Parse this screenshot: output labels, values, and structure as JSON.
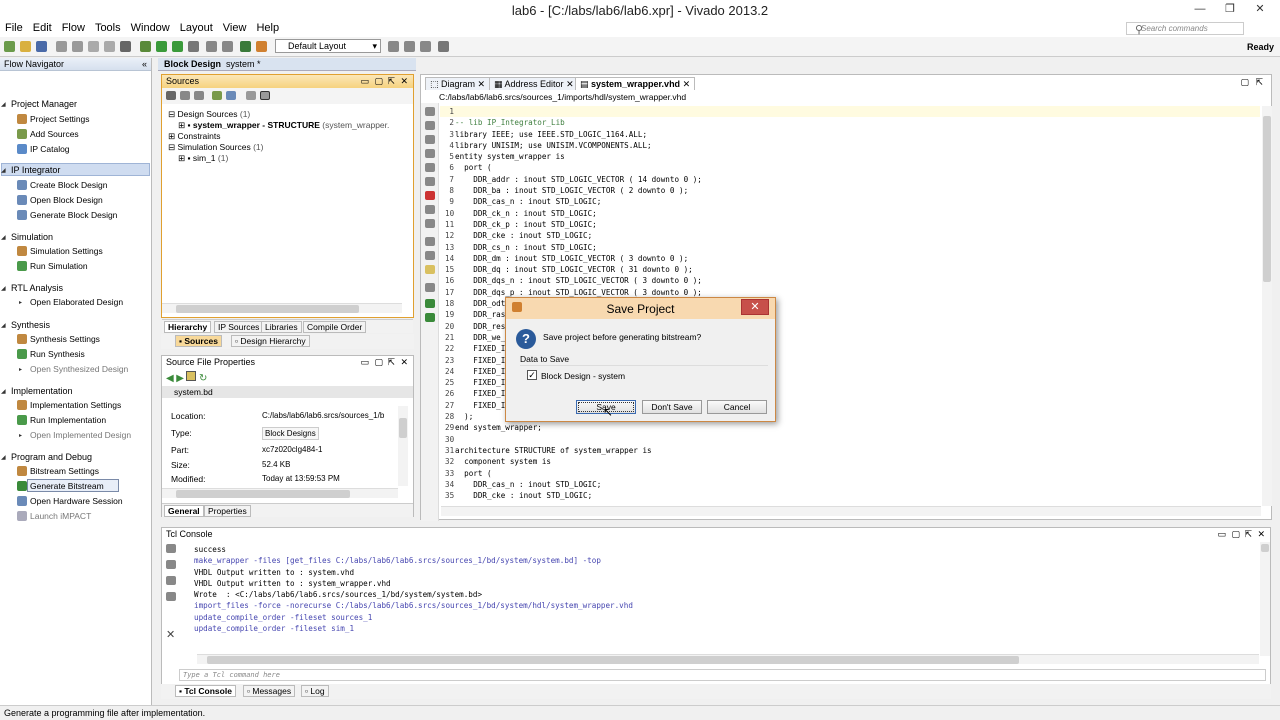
{
  "window": {
    "title": "lab6 - [C:/labs/lab6/lab6.xpr] - Vivado 2013.2",
    "min": "—",
    "max": "❐",
    "close": "✕"
  },
  "menu": [
    "File",
    "Edit",
    "Flow",
    "Tools",
    "Window",
    "Layout",
    "View",
    "Help"
  ],
  "search": {
    "placeholder": "Search commands"
  },
  "toolbar": {
    "layout": "Default Layout",
    "status": "Ready"
  },
  "flow_navigator": {
    "title": "Flow Navigator",
    "sections": [
      {
        "label": "Project Manager",
        "items": [
          "Project Settings",
          "Add Sources",
          "IP Catalog"
        ]
      },
      {
        "label": "IP Integrator",
        "items": [
          "Create Block Design",
          "Open Block Design",
          "Generate Block Design"
        ]
      },
      {
        "label": "Simulation",
        "items": [
          "Simulation Settings",
          "Run Simulation"
        ]
      },
      {
        "label": "RTL Analysis",
        "items": [
          "Open Elaborated Design"
        ]
      },
      {
        "label": "Synthesis",
        "items": [
          "Synthesis Settings",
          "Run Synthesis",
          "Open Synthesized Design"
        ]
      },
      {
        "label": "Implementation",
        "items": [
          "Implementation Settings",
          "Run Implementation",
          "Open Implemented Design"
        ]
      },
      {
        "label": "Program and Debug",
        "items": [
          "Bitstream Settings",
          "Generate Bitstream",
          "Open Hardware Session",
          "Launch iMPACT"
        ]
      }
    ]
  },
  "block_design": {
    "title": "Block Design",
    "name": "system *"
  },
  "sources": {
    "title": "Sources",
    "design_sources": "Design Sources",
    "design_count": "(1)",
    "wrapper": "system_wrapper - STRUCTURE",
    "wrapper_file": "(system_wrapper.",
    "constraints": "Constraints",
    "sim_sources": "Simulation Sources",
    "sim_count": "(1)",
    "sim1": "sim_1",
    "sim1_count": "(1)",
    "tabs": [
      "Hierarchy",
      "IP Sources",
      "Libraries",
      "Compile Order"
    ],
    "subtabs": [
      "Sources",
      "Design Hierarchy"
    ]
  },
  "sfp": {
    "title": "Source File Properties",
    "file": "system.bd",
    "props": [
      {
        "label": "Location:",
        "value": "C:/labs/lab6/lab6.srcs/sources_1/b"
      },
      {
        "label": "Type:",
        "value": "Block Designs"
      },
      {
        "label": "Part:",
        "value": "xc7z020clg484-1"
      },
      {
        "label": "Size:",
        "value": "52.4 KB"
      },
      {
        "label": "Modified:",
        "value": "Today at 13:59:53 PM"
      }
    ],
    "tabs": [
      "General",
      "Properties"
    ]
  },
  "editor": {
    "tabs": [
      "Diagram",
      "Address Editor",
      "system_wrapper.vhd"
    ],
    "path": "C:/labs/lab6/lab6.srcs/sources_1/imports/hdl/system_wrapper.vhd",
    "lines": [
      {
        "n": "1",
        "t": ""
      },
      {
        "n": "2",
        "t": "-- lib IP_Integrator_Lib"
      },
      {
        "n": "3",
        "t": "library IEEE; use IEEE.STD_LOGIC_1164.ALL;"
      },
      {
        "n": "4",
        "t": "library UNISIM; use UNISIM.VCOMPONENTS.ALL;"
      },
      {
        "n": "5",
        "t": "entity system_wrapper is"
      },
      {
        "n": "6",
        "t": "  port ("
      },
      {
        "n": "7",
        "t": "    DDR_addr : inout STD_LOGIC_VECTOR ( 14 downto 0 );"
      },
      {
        "n": "8",
        "t": "    DDR_ba : inout STD_LOGIC_VECTOR ( 2 downto 0 );"
      },
      {
        "n": "9",
        "t": "    DDR_cas_n : inout STD_LOGIC;"
      },
      {
        "n": "10",
        "t": "    DDR_ck_n : inout STD_LOGIC;"
      },
      {
        "n": "11",
        "t": "    DDR_ck_p : inout STD_LOGIC;"
      },
      {
        "n": "12",
        "t": "    DDR_cke : inout STD_LOGIC;"
      },
      {
        "n": "13",
        "t": "    DDR_cs_n : inout STD_LOGIC;"
      },
      {
        "n": "14",
        "t": "    DDR_dm : inout STD_LOGIC_VECTOR ( 3 downto 0 );"
      },
      {
        "n": "15",
        "t": "    DDR_dq : inout STD_LOGIC_VECTOR ( 31 downto 0 );"
      },
      {
        "n": "16",
        "t": "    DDR_dqs_n : inout STD_LOGIC_VECTOR ( 3 downto 0 );"
      },
      {
        "n": "17",
        "t": "    DDR_dqs_p : inout STD_LOGIC_VECTOR ( 3 downto 0 );"
      },
      {
        "n": "18",
        "t": "    DDR_odt"
      },
      {
        "n": "19",
        "t": "    DDR_ras"
      },
      {
        "n": "20",
        "t": "    DDR_res"
      },
      {
        "n": "21",
        "t": "    DDR_we_"
      },
      {
        "n": "22",
        "t": "    FIXED_I"
      },
      {
        "n": "23",
        "t": "    FIXED_I"
      },
      {
        "n": "24",
        "t": "    FIXED_I"
      },
      {
        "n": "25",
        "t": "    FIXED_I"
      },
      {
        "n": "26",
        "t": "    FIXED_I"
      },
      {
        "n": "27",
        "t": "    FIXED_I"
      },
      {
        "n": "28",
        "t": "  );"
      },
      {
        "n": "29",
        "t": "end system_wrapper;"
      },
      {
        "n": "30",
        "t": ""
      },
      {
        "n": "31",
        "t": "architecture STRUCTURE of system_wrapper is"
      },
      {
        "n": "32",
        "t": "  component system is"
      },
      {
        "n": "33",
        "t": "  port ("
      },
      {
        "n": "34",
        "t": "    DDR_cas_n : inout STD_LOGIC;"
      },
      {
        "n": "35",
        "t": "    DDR_cke : inout STD_LOGIC;"
      }
    ]
  },
  "tcl": {
    "title": "Tcl Console",
    "lines": [
      {
        "t": "success",
        "cmd": false
      },
      {
        "t": "make_wrapper -files [get_files C:/labs/lab6/lab6.srcs/sources_1/bd/system/system.bd] -top",
        "cmd": true
      },
      {
        "t": "VHDL Output written to : system.vhd",
        "cmd": false
      },
      {
        "t": "VHDL Output written to : system_wrapper.vhd",
        "cmd": false
      },
      {
        "t": "Wrote  : <C:/labs/lab6/lab6.srcs/sources_1/bd/system/system.bd>",
        "cmd": false
      },
      {
        "t": "import_files -force -norecurse C:/labs/lab6/lab6.srcs/sources_1/bd/system/hdl/system_wrapper.vhd",
        "cmd": true
      },
      {
        "t": "update_compile_order -fileset sources_1",
        "cmd": true
      },
      {
        "t": "update_compile_order -fileset sim_1",
        "cmd": true
      }
    ],
    "input_placeholder": "Type a Tcl command here",
    "tabs": [
      "Tcl Console",
      "Messages",
      "Log"
    ]
  },
  "status_bar": "Generate a programming file after implementation.",
  "dialog": {
    "title": "Save Project",
    "message": "Save project before generating bitstream?",
    "group": "Data to Save",
    "checkbox": "Block Design - system",
    "buttons": {
      "save": "Save",
      "dont_save": "Don't Save",
      "cancel": "Cancel"
    }
  }
}
